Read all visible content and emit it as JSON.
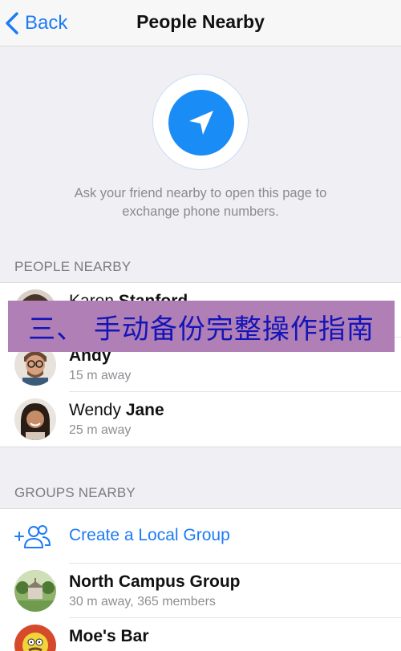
{
  "nav": {
    "back_label": "Back",
    "title": "People Nearby"
  },
  "hero": {
    "icon": "location-arrow-icon",
    "text_line1": "Ask your friend nearby to open this page to",
    "text_line2": "exchange phone numbers."
  },
  "people_nearby": {
    "header": "PEOPLE NEARBY",
    "items": [
      {
        "first": "Karen ",
        "last": "Stanford",
        "distance": "",
        "avatar": "karen-avatar"
      },
      {
        "first": "",
        "last": "Andy",
        "distance": "15 m away",
        "avatar": "andy-avatar"
      },
      {
        "first": "Wendy ",
        "last": "Jane",
        "distance": "25 m away",
        "avatar": "wendy-avatar"
      }
    ]
  },
  "groups_nearby": {
    "header": "GROUPS NEARBY",
    "create_label": "Create a Local Group",
    "create_icon": "add-group-icon",
    "items": [
      {
        "name": "North Campus Group",
        "details": "30 m away, 365 members",
        "avatar": "campus-avatar"
      },
      {
        "name": "Moe's Bar",
        "details": "",
        "avatar": "moes-bar-avatar"
      }
    ]
  },
  "overlay": {
    "text": "三、 手动备份完整操作指南"
  },
  "colors": {
    "accent": "#1c7bf5",
    "background": "#efeff4",
    "overlay_bg": "#b07fb5",
    "overlay_text": "#1414b8"
  }
}
